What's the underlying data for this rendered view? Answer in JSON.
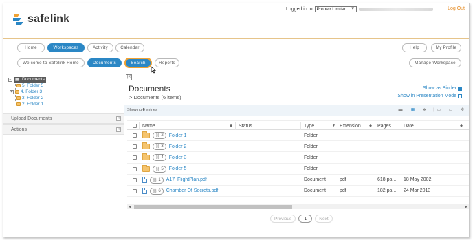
{
  "header": {
    "logo_text": "safelink",
    "logged_in_label": "Logged in to",
    "tenant": "Propelr Limited",
    "logout": "Log Out"
  },
  "nav": {
    "home": "Home",
    "workspaces": "Workspaces",
    "activity": "Activity",
    "calendar": "Calendar",
    "help": "Help",
    "my_profile": "My Profile",
    "welcome": "Welcome to Safelink Home",
    "documents": "Documents",
    "search": "Search",
    "reports": "Reports",
    "manage_workspace": "Manage Workspace"
  },
  "tree": {
    "root": "Documents",
    "items": [
      "5. Folder 5",
      "4. Folder 3",
      "3. Folder 2",
      "2. Folder 1"
    ]
  },
  "sidebar": {
    "upload": "Upload Documents",
    "actions": "Actions"
  },
  "main": {
    "title": "Documents",
    "subtitle": "> Documents (6 items)",
    "show_as_binder": "Show as Binder",
    "presentation_mode": "Show in Presentation Mode",
    "showing_prefix": "Showing",
    "showing_count": "6",
    "showing_suffix": "entries"
  },
  "table": {
    "columns": {
      "name": "Name",
      "status": "Status",
      "type": "Type",
      "extension": "Extension",
      "pages": "Pages",
      "date": "Date"
    },
    "rows": [
      {
        "version": "2",
        "name": "Folder 1",
        "status": "",
        "type": "Folder",
        "extension": "",
        "pages": "",
        "date": "",
        "kind": "folder"
      },
      {
        "version": "3",
        "name": "Folder 2",
        "status": "",
        "type": "Folder",
        "extension": "",
        "pages": "",
        "date": "",
        "kind": "folder"
      },
      {
        "version": "4",
        "name": "Folder 3",
        "status": "",
        "type": "Folder",
        "extension": "",
        "pages": "",
        "date": "",
        "kind": "folder"
      },
      {
        "version": "5",
        "name": "Folder 5",
        "status": "",
        "type": "Folder",
        "extension": "",
        "pages": "",
        "date": "",
        "kind": "folder"
      },
      {
        "version": "1",
        "name": "A17_FlightPlan.pdf",
        "status": "",
        "type": "Document",
        "extension": "pdf",
        "pages": "618 pa...",
        "date": "18 May 2002",
        "kind": "pdf"
      },
      {
        "version": "6",
        "name": "Chamber Of Secrets.pdf",
        "status": "",
        "type": "Document",
        "extension": "pdf",
        "pages": "182 pa...",
        "date": "24 Mar 2013",
        "kind": "pdf"
      }
    ]
  },
  "pager": {
    "previous": "Previous",
    "current": "1",
    "next": "Next"
  },
  "colors": {
    "accent": "#2b87c5",
    "highlight": "#f0a233",
    "folder": "#f5c46e",
    "logout": "#e58a1f"
  }
}
